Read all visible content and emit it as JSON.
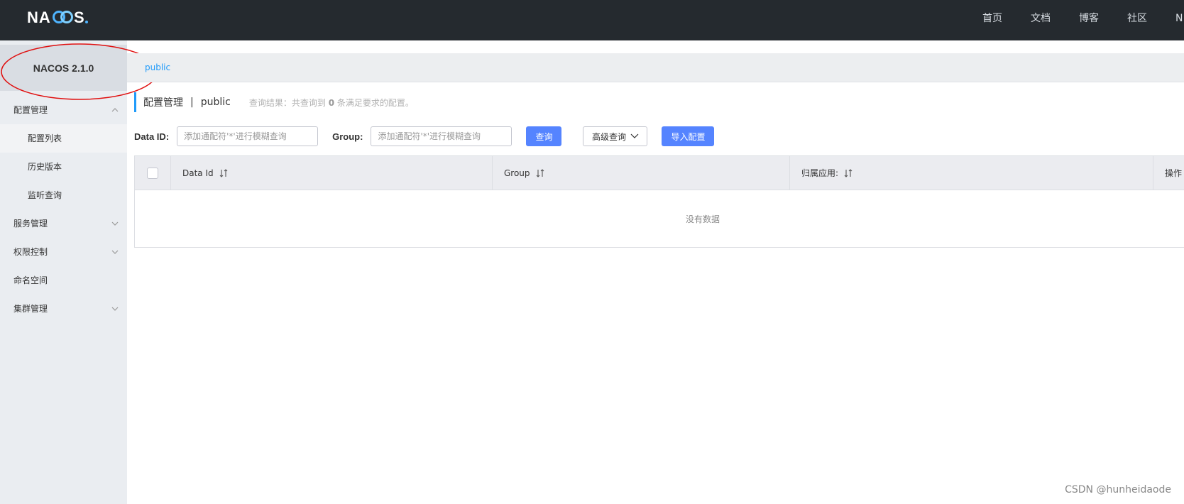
{
  "header": {
    "logo": "NACOS.",
    "nav": [
      "首页",
      "文档",
      "博客",
      "社区",
      "N"
    ]
  },
  "sidebar": {
    "version": "NACOS 2.1.0",
    "items": [
      {
        "label": "配置管理",
        "type": "group",
        "expanded": true
      },
      {
        "label": "配置列表",
        "type": "sub",
        "active": true
      },
      {
        "label": "历史版本",
        "type": "sub"
      },
      {
        "label": "监听查询",
        "type": "sub"
      },
      {
        "label": "服务管理",
        "type": "group"
      },
      {
        "label": "权限控制",
        "type": "group"
      },
      {
        "label": "命名空间",
        "type": "item"
      },
      {
        "label": "集群管理",
        "type": "group"
      }
    ]
  },
  "namespace_bar": {
    "current": "public"
  },
  "title": {
    "section": "配置管理",
    "separator": "|",
    "namespace": "public",
    "result_prefix": "查询结果：共查询到",
    "result_count": "0",
    "result_suffix": "条满足要求的配置。"
  },
  "search": {
    "data_id_label": "Data ID:",
    "data_id_placeholder": "添加通配符'*'进行模糊查询",
    "group_label": "Group:",
    "group_placeholder": "添加通配符'*'进行模糊查询",
    "query_button": "查询",
    "advanced_button": "高级查询",
    "import_button": "导入配置"
  },
  "table": {
    "columns": [
      "Data Id",
      "Group",
      "归属应用:",
      "操作"
    ],
    "empty_text": "没有数据"
  },
  "watermark": "CSDN @hunheidaode",
  "colors": {
    "accent": "#209bfa",
    "primary_button": "#5584ff",
    "topbar": "#252a2f",
    "annotation": "#e01010"
  }
}
